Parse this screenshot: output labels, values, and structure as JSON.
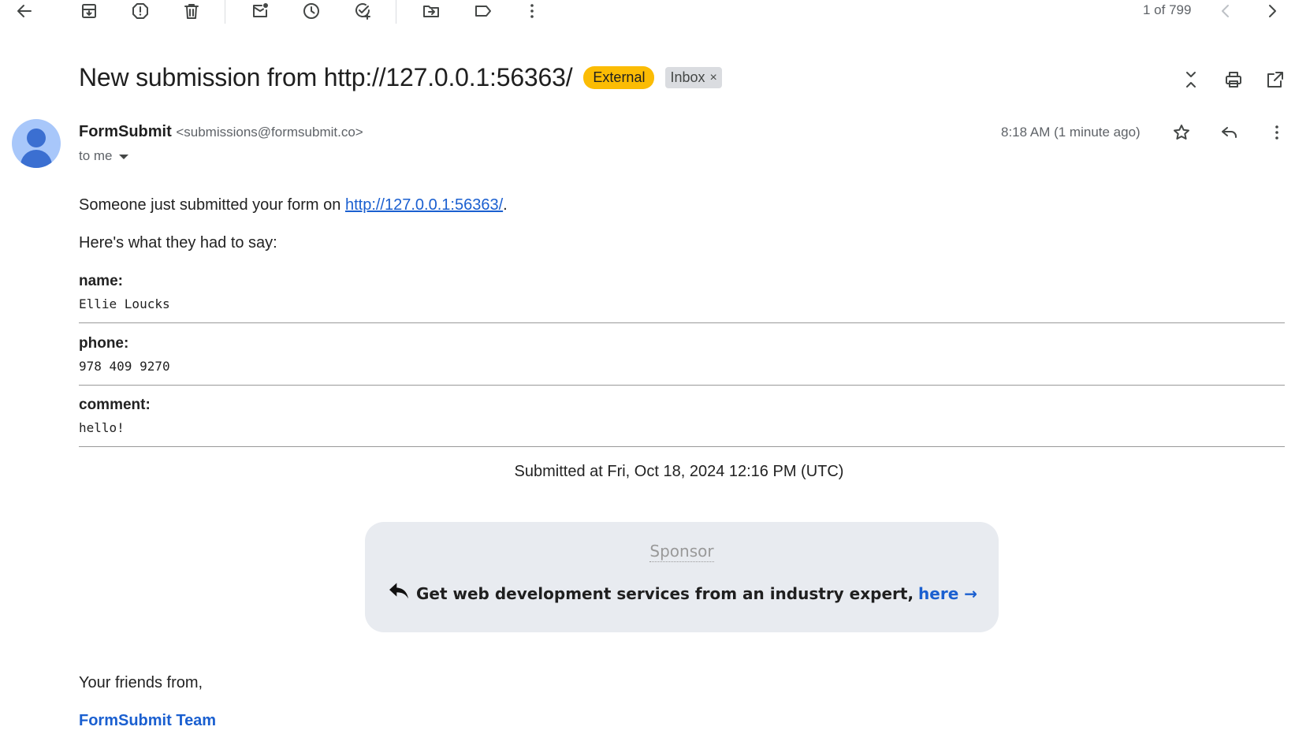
{
  "toolbar": {
    "icons": [
      "back-arrow-icon",
      "archive-icon",
      "report-spam-icon",
      "delete-icon",
      "mark-unread-icon",
      "snooze-icon",
      "add-to-tasks-icon",
      "move-to-icon",
      "labels-icon",
      "more-vert-icon"
    ],
    "pager": "1 of 799"
  },
  "header": {
    "subject": "New submission from http://127.0.0.1:56363/",
    "badge_external": "External",
    "badge_inbox": "Inbox",
    "badge_inbox_close": "×"
  },
  "sender": {
    "name": "FormSubmit",
    "email": "<submissions@formsubmit.co>",
    "to": "to me",
    "time": "8:18 AM (1 minute ago)"
  },
  "message": {
    "intro_prefix": "Someone just submitted your form on ",
    "intro_link": "http://127.0.0.1:56363/",
    "intro_suffix": ".",
    "lead": "Here's what they had to say:",
    "fields": [
      {
        "label": "name:",
        "value": "Ellie Loucks"
      },
      {
        "label": "phone:",
        "value": "978 409 9270"
      },
      {
        "label": "comment:",
        "value": "hello!"
      }
    ],
    "submitted": "Submitted at Fri, Oct 18, 2024 12:16 PM (UTC)",
    "sponsor_title": "Sponsor",
    "sponsor_text": "Get web development services from an industry expert, ",
    "sponsor_link": "here →",
    "signoff": "Your friends from,",
    "team": "FormSubmit Team"
  },
  "colors": {
    "accent_link": "#1a5fd0",
    "external_badge": "#fbbc04",
    "sponsor_bg": "#e8ebf0"
  }
}
